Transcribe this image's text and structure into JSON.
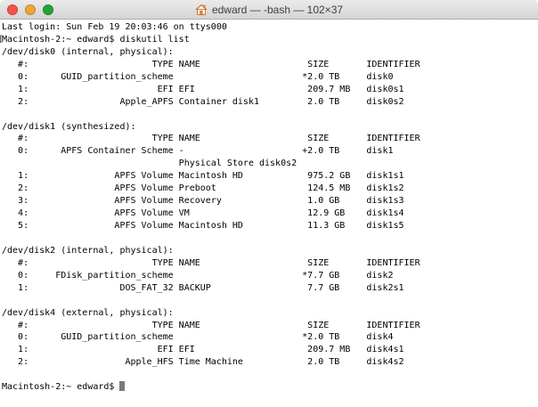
{
  "window": {
    "title": "edward — -bash — 102×37",
    "traffic_lights": {
      "close": "#f7514b",
      "minimize": "#f0a43c",
      "zoom": "#25a334"
    }
  },
  "terminal": {
    "cursor_color": "#7a7a7a",
    "last_login": "Last login: Sun Feb 19 20:03:46 on ttys000",
    "prompt": "Macintosh-2:~ edward$",
    "command": "diskutil list",
    "lines": [
      {
        "text": "Last login: Sun Feb 19 20:03:46 on ttys000"
      },
      {
        "text": "Macintosh-2:~ edward$ diskutil list",
        "mark": true
      },
      {
        "text": "/dev/disk0 (internal, physical):"
      },
      {
        "text": "   #:                       TYPE NAME                    SIZE       IDENTIFIER"
      },
      {
        "text": "   0:      GUID_partition_scheme                        *2.0 TB     disk0"
      },
      {
        "text": "   1:                        EFI EFI                     209.7 MB   disk0s1"
      },
      {
        "text": "   2:                 Apple_APFS Container disk1         2.0 TB     disk0s2"
      },
      {
        "text": ""
      },
      {
        "text": "/dev/disk1 (synthesized):"
      },
      {
        "text": "   #:                       TYPE NAME                    SIZE       IDENTIFIER"
      },
      {
        "text": "   0:      APFS Container Scheme -                      +2.0 TB     disk1"
      },
      {
        "text": "                                 Physical Store disk0s2"
      },
      {
        "text": "   1:                APFS Volume Macintosh HD            975.2 GB   disk1s1"
      },
      {
        "text": "   2:                APFS Volume Preboot                 124.5 MB   disk1s2"
      },
      {
        "text": "   3:                APFS Volume Recovery                1.0 GB     disk1s3"
      },
      {
        "text": "   4:                APFS Volume VM                      12.9 GB    disk1s4"
      },
      {
        "text": "   5:                APFS Volume Macintosh HD            11.3 GB    disk1s5"
      },
      {
        "text": ""
      },
      {
        "text": "/dev/disk2 (internal, physical):"
      },
      {
        "text": "   #:                       TYPE NAME                    SIZE       IDENTIFIER"
      },
      {
        "text": "   0:     FDisk_partition_scheme                        *7.7 GB     disk2"
      },
      {
        "text": "   1:                 DOS_FAT_32 BACKUP                  7.7 GB     disk2s1"
      },
      {
        "text": ""
      },
      {
        "text": "/dev/disk4 (external, physical):"
      },
      {
        "text": "   #:                       TYPE NAME                    SIZE       IDENTIFIER"
      },
      {
        "text": "   0:      GUID_partition_scheme                        *2.0 TB     disk4"
      },
      {
        "text": "   1:                        EFI EFI                     209.7 MB   disk4s1"
      },
      {
        "text": "   2:                  Apple_HFS Time Machine            2.0 TB     disk4s2"
      },
      {
        "text": ""
      },
      {
        "text": "Macintosh-2:~ edward$ ",
        "cursor": true
      }
    ]
  }
}
